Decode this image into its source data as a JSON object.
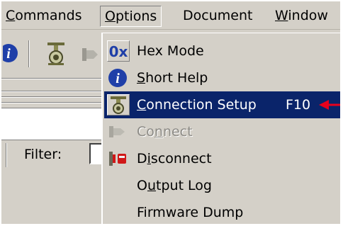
{
  "menubar": {
    "commands": {
      "u": "C",
      "rest": "ommands"
    },
    "options": {
      "u": "O",
      "rest": "ptions"
    },
    "document": {
      "label": "Document"
    },
    "window": {
      "u": "W",
      "rest": "indow"
    }
  },
  "filter": {
    "label": "Filter:"
  },
  "options_menu": {
    "items": [
      {
        "icon": "hex-0x-icon",
        "icon_text": "0x",
        "label": "Hex Mode",
        "state": "normal"
      },
      {
        "icon": "info-icon",
        "icon_text": "i",
        "u": "S",
        "rest": "hort Help",
        "state": "normal"
      },
      {
        "icon": "connection-setup-icon",
        "u": "C",
        "rest": "onnection Setup",
        "shortcut": "F10",
        "state": "selected"
      },
      {
        "icon": "plug-connect-icon",
        "pre": "Co",
        "u": "n",
        "rest": "nect",
        "state": "disabled"
      },
      {
        "icon": "plug-disconnect-icon",
        "pre": "D",
        "u": "i",
        "rest": "sconnect",
        "state": "normal"
      },
      {
        "pre": "O",
        "u": "u",
        "rest": "tput Log",
        "state": "normal"
      },
      {
        "label": "Firmware Dump",
        "state": "normal"
      }
    ]
  },
  "colors": {
    "menu_bg": "#d4d0c8",
    "highlight": "#0a246a",
    "arrow": "#e8001c",
    "info_blue": "#1f3fa8"
  }
}
